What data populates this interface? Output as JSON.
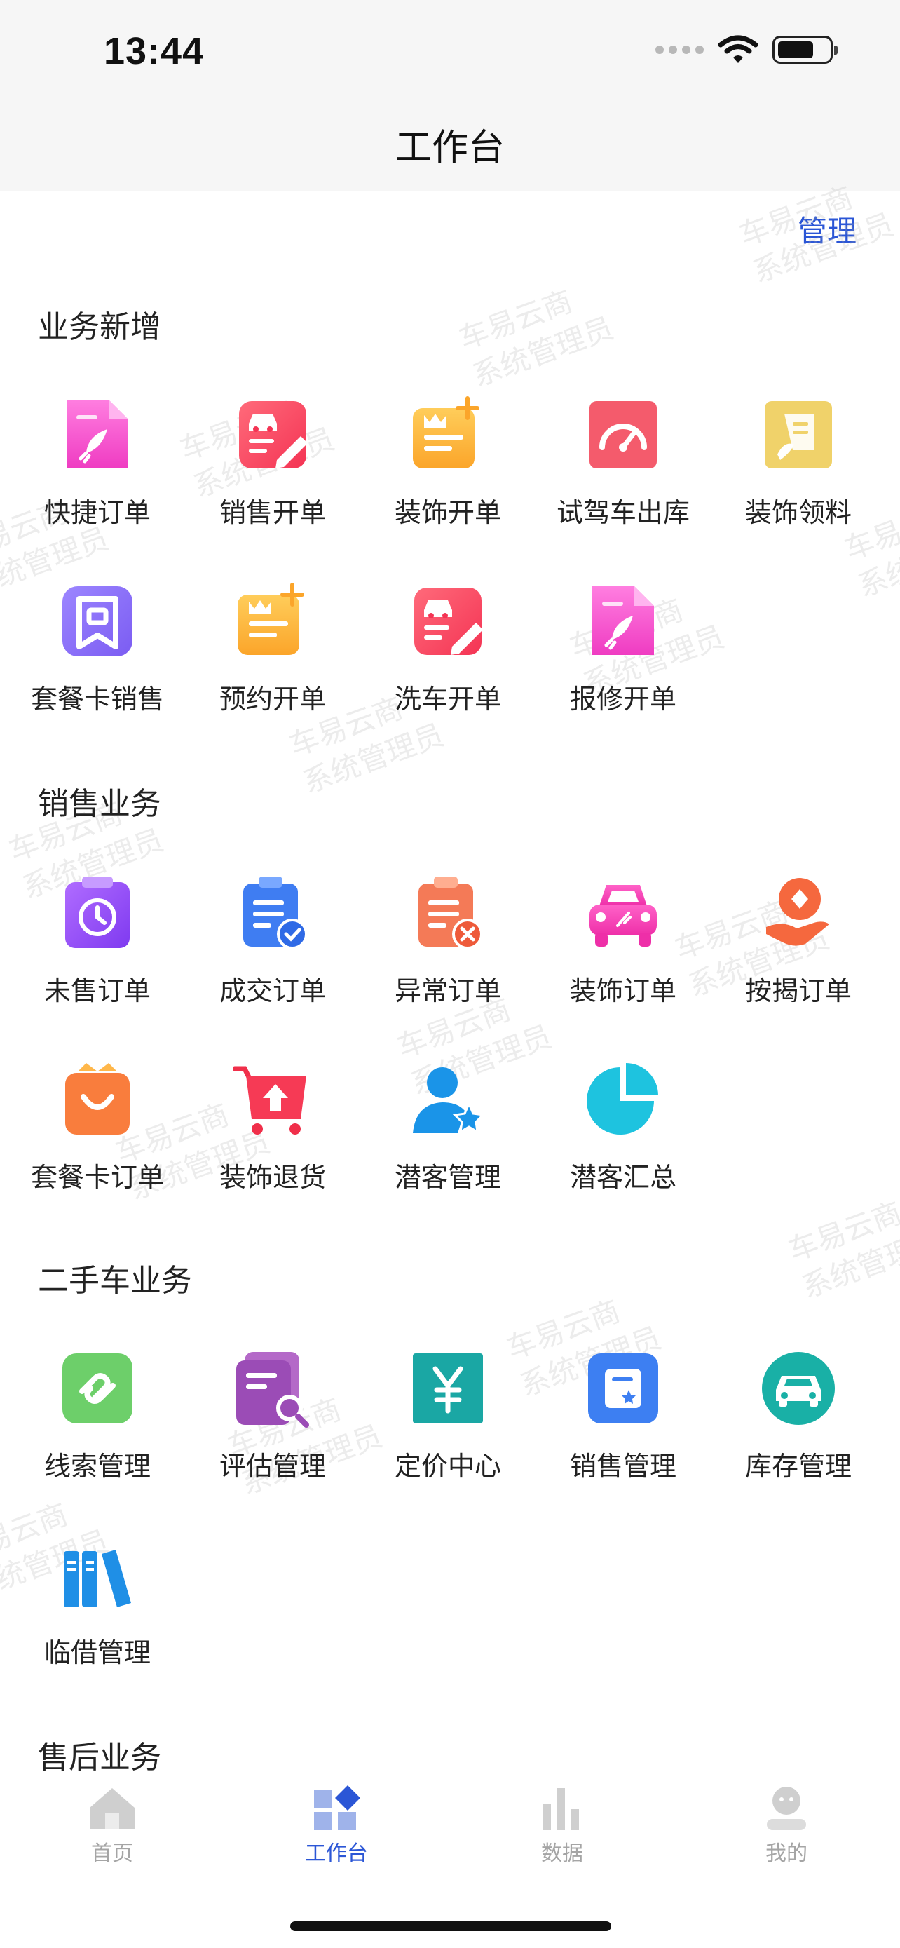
{
  "status_bar": {
    "time": "13:44"
  },
  "header": {
    "title": "工作台",
    "manage": "管理"
  },
  "watermark": {
    "line1": "车易云商",
    "line2": "系统管理员"
  },
  "sections": [
    {
      "title": "业务新增",
      "items": [
        {
          "label": "快捷订单",
          "icon": "rocket-doc-icon"
        },
        {
          "label": "销售开单",
          "icon": "car-edit-icon"
        },
        {
          "label": "装饰开单",
          "icon": "crown-plus-icon"
        },
        {
          "label": "试驾车出库",
          "icon": "speedometer-icon"
        },
        {
          "label": "装饰领料",
          "icon": "document-hand-icon"
        },
        {
          "label": "套餐卡销售",
          "icon": "bookmark-card-icon"
        },
        {
          "label": "预约开单",
          "icon": "crown-plus-icon"
        },
        {
          "label": "洗车开单",
          "icon": "car-edit-icon"
        },
        {
          "label": "报修开单",
          "icon": "rocket-doc-icon"
        }
      ]
    },
    {
      "title": "销售业务",
      "items": [
        {
          "label": "未售订单",
          "icon": "clock-clipboard-icon"
        },
        {
          "label": "成交订单",
          "icon": "check-clipboard-icon"
        },
        {
          "label": "异常订单",
          "icon": "x-clipboard-icon"
        },
        {
          "label": "装饰订单",
          "icon": "car-sparkle-icon"
        },
        {
          "label": "按揭订单",
          "icon": "hand-diamond-icon"
        },
        {
          "label": "套餐卡订单",
          "icon": "shopping-bag-icon"
        },
        {
          "label": "装饰退货",
          "icon": "cart-return-icon"
        },
        {
          "label": "潜客管理",
          "icon": "user-star-icon"
        },
        {
          "label": "潜客汇总",
          "icon": "pie-chart-icon"
        }
      ]
    },
    {
      "title": "二手车业务",
      "items": [
        {
          "label": "线索管理",
          "icon": "link-icon"
        },
        {
          "label": "评估管理",
          "icon": "report-search-icon"
        },
        {
          "label": "定价中心",
          "icon": "yuan-icon"
        },
        {
          "label": "销售管理",
          "icon": "star-card-icon"
        },
        {
          "label": "库存管理",
          "icon": "car-circle-icon"
        },
        {
          "label": "临借管理",
          "icon": "books-icon"
        }
      ]
    },
    {
      "title": "售后业务",
      "items": []
    }
  ],
  "tabbar": {
    "active": "工作台",
    "tabs": [
      {
        "label": "首页",
        "icon": "home-icon"
      },
      {
        "label": "工作台",
        "icon": "workbench-icon"
      },
      {
        "label": "数据",
        "icon": "bar-chart-icon"
      },
      {
        "label": "我的",
        "icon": "profile-icon"
      }
    ]
  },
  "colors": {
    "accent": "#2b56d6",
    "header_bg": "#f6f6f6"
  }
}
